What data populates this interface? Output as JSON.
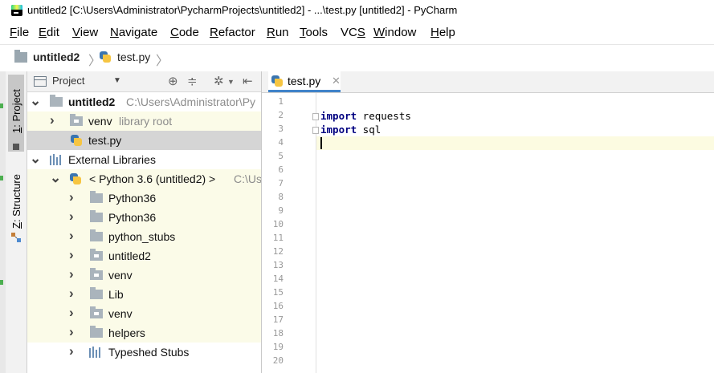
{
  "window": {
    "title": "untitled2 [C:\\Users\\Administrator\\PycharmProjects\\untitled2] - ...\\test.py [untitled2] - PyCharm"
  },
  "menu": [
    {
      "u": "F",
      "rest": "ile"
    },
    {
      "u": "E",
      "rest": "dit"
    },
    {
      "u": "V",
      "rest": "iew"
    },
    {
      "u": "N",
      "rest": "avigate"
    },
    {
      "u": "C",
      "rest": "ode"
    },
    {
      "u": "R",
      "rest": "efactor"
    },
    {
      "u": "R",
      "rest": "un"
    },
    {
      "u": "T",
      "rest": "ools"
    },
    {
      "pre": "VC",
      "u": "S",
      "rest": ""
    },
    {
      "u": "W",
      "rest": "indow"
    },
    {
      "u": "H",
      "rest": "elp"
    }
  ],
  "navbar": {
    "project": "untitled2",
    "file": "test.py"
  },
  "toolwindows": {
    "project": {
      "u": "1",
      "rest": ": Project"
    },
    "structure": {
      "u": "Z",
      "rest": ": Structure"
    }
  },
  "project_panel": {
    "title": "Project",
    "tree": [
      {
        "label": "untitled2",
        "hint": "C:\\Users\\Administrator\\Py"
      },
      {
        "label": "venv",
        "hint": "library root"
      },
      {
        "label": "test.py"
      },
      {
        "label": "External Libraries"
      },
      {
        "label": "< Python 3.6 (untitled2) >",
        "hint": "C:\\Us"
      },
      {
        "label": "Python36"
      },
      {
        "label": "Python36"
      },
      {
        "label": "python_stubs"
      },
      {
        "label": "untitled2"
      },
      {
        "label": "venv"
      },
      {
        "label": "Lib"
      },
      {
        "label": "venv"
      },
      {
        "label": "helpers"
      },
      {
        "label": "Typeshed Stubs"
      }
    ]
  },
  "editor": {
    "tab": "test.py",
    "line_numbers": [
      "1",
      "2",
      "3",
      "4",
      "5",
      "6",
      "7",
      "8",
      "9",
      "10",
      "11",
      "12",
      "13",
      "14",
      "15",
      "16",
      "17",
      "18",
      "19",
      "20"
    ],
    "code": [
      {
        "kw": "import",
        "rest": " requests"
      },
      {
        "kw": "import",
        "rest": " sql"
      }
    ]
  }
}
